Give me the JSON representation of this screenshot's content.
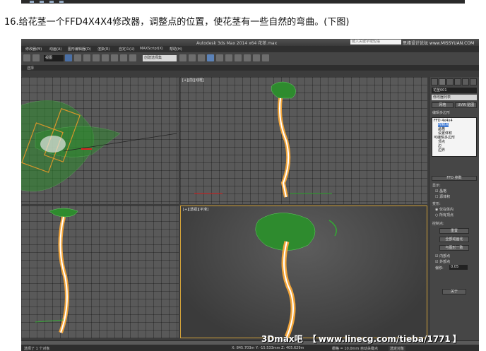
{
  "caption": "16.给花茎一个FFD4X4X4修改器，调整点的位置，使花茎有一些自然的弯曲。(下图)",
  "app": {
    "title": "Autodesk 3ds Max 2014 x64    花茎.max",
    "search_placeholder": "键入关键字或短语",
    "watermark_top": "思缘设计论坛 www.MISSYUAN.COM",
    "menus": [
      "修改器(M)",
      "动画(A)",
      "图形编辑器(D)",
      "渲染(R)",
      "自定义(U)",
      "MAXScript(X)",
      "帮助(H)"
    ],
    "selection_dropdown": "视图",
    "named_selection": "创建选择集",
    "subbar_label": "选择",
    "viewports": {
      "perspective_label": "[+][透视][平滑]",
      "front_label": "[+][前][线框]",
      "left_label": "[+][左][线框]",
      "top_label": "[+][顶][线框]"
    }
  },
  "command_panel": {
    "object_name": "花茎001",
    "modifier_list": "修改器列表",
    "buttons": {
      "subdiv": "网格",
      "uvw": "UVW 贴图"
    },
    "edit_poly_label": "编辑多边形",
    "stack": [
      {
        "label": "FFD 4x4x4",
        "highlight": false
      },
      {
        "label": "控制点",
        "highlight": true
      },
      {
        "label": "晶格",
        "highlight": false
      },
      {
        "label": "设置体积",
        "highlight": false
      },
      {
        "label": "可编辑多边形",
        "highlight": false
      },
      {
        "label": "顶点",
        "highlight": false
      },
      {
        "label": "边",
        "highlight": false
      },
      {
        "label": "边界",
        "highlight": false
      }
    ],
    "ffd_rollout": "FFD 参数",
    "display_label": "显示:",
    "display_options": [
      "晶格",
      "源体积"
    ],
    "deform_label": "变形:",
    "deform_options": [
      "仅在体内",
      "所有顶点"
    ],
    "control_points_label": "控制点:",
    "cp_buttons": [
      "重置",
      "全部动画化",
      "与图形一致"
    ],
    "cp_checks": [
      "内部点",
      "外部点"
    ],
    "offset_label": "偏移:",
    "offset_value": "0.05",
    "about_button": "关于"
  },
  "status": {
    "selected": "选择了 1 个对象",
    "coords": "X: 845.703m   Y: -15.533mm   Z: 405.629m",
    "grid": "栅格 = 10.0mm",
    "autokey": "自动关键点",
    "selected_dropdown": "选定对象"
  },
  "watermark": {
    "left": "3Dmax吧",
    "bracket_open": "【",
    "url": "www.linecg.com/tieba/1771",
    "bracket_close": "】"
  }
}
